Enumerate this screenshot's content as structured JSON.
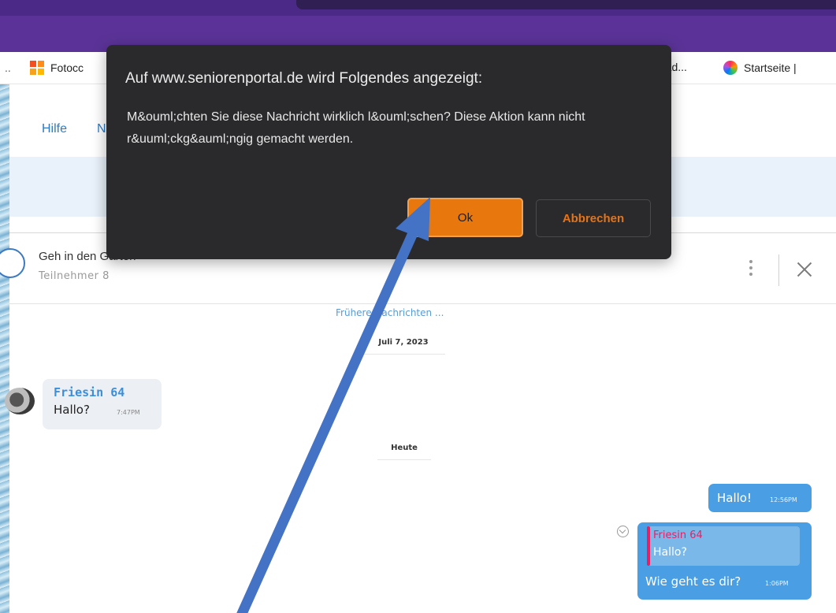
{
  "browser": {
    "bookmarks": {
      "overflow": "..",
      "items": [
        {
          "label": "Fotocc",
          "icon": "microsoft-tile-icon"
        },
        {
          "label": "nload...",
          "icon": "none"
        },
        {
          "label": "Startseite |",
          "icon": "creative-cloud-icon"
        }
      ]
    }
  },
  "site": {
    "nav": {
      "help": "Hilfe",
      "partial": "N"
    }
  },
  "chat": {
    "title": "Geh in den Garten",
    "participants": "Teilnehmer 8",
    "earlier_messages": "Frühere Nachrichten ...",
    "dates": {
      "first": "Juli 7, 2023",
      "today": "Heute"
    },
    "messages": [
      {
        "sender": "Friesin 64",
        "text": "Hallo?",
        "time": "7:47PM",
        "direction": "in"
      },
      {
        "text": "Hallo!",
        "time": "12:56PM",
        "direction": "out"
      },
      {
        "quote_sender": "Friesin 64",
        "quote_text": "Hallo?",
        "text": "Wie geht es dir?",
        "time": "1:06PM",
        "direction": "out"
      }
    ]
  },
  "dialog": {
    "title": "Auf www.seniorenportal.de wird Folgendes angezeigt:",
    "message": "M&ouml;chten Sie diese Nachricht wirklich l&ouml;schen? Diese Aktion kann nicht r&uuml;ckg&auml;ngig gemacht werden.",
    "ok_label": "Ok",
    "cancel_label": "Abbrechen"
  },
  "colors": {
    "browser_toolbar": "#5b3398",
    "dialog_bg": "#2a2a2c",
    "ok_button": "#e8780e",
    "cancel_text": "#e3741b",
    "arrow": "#4472c4",
    "outgoing_bubble": "#4a9fe4"
  }
}
